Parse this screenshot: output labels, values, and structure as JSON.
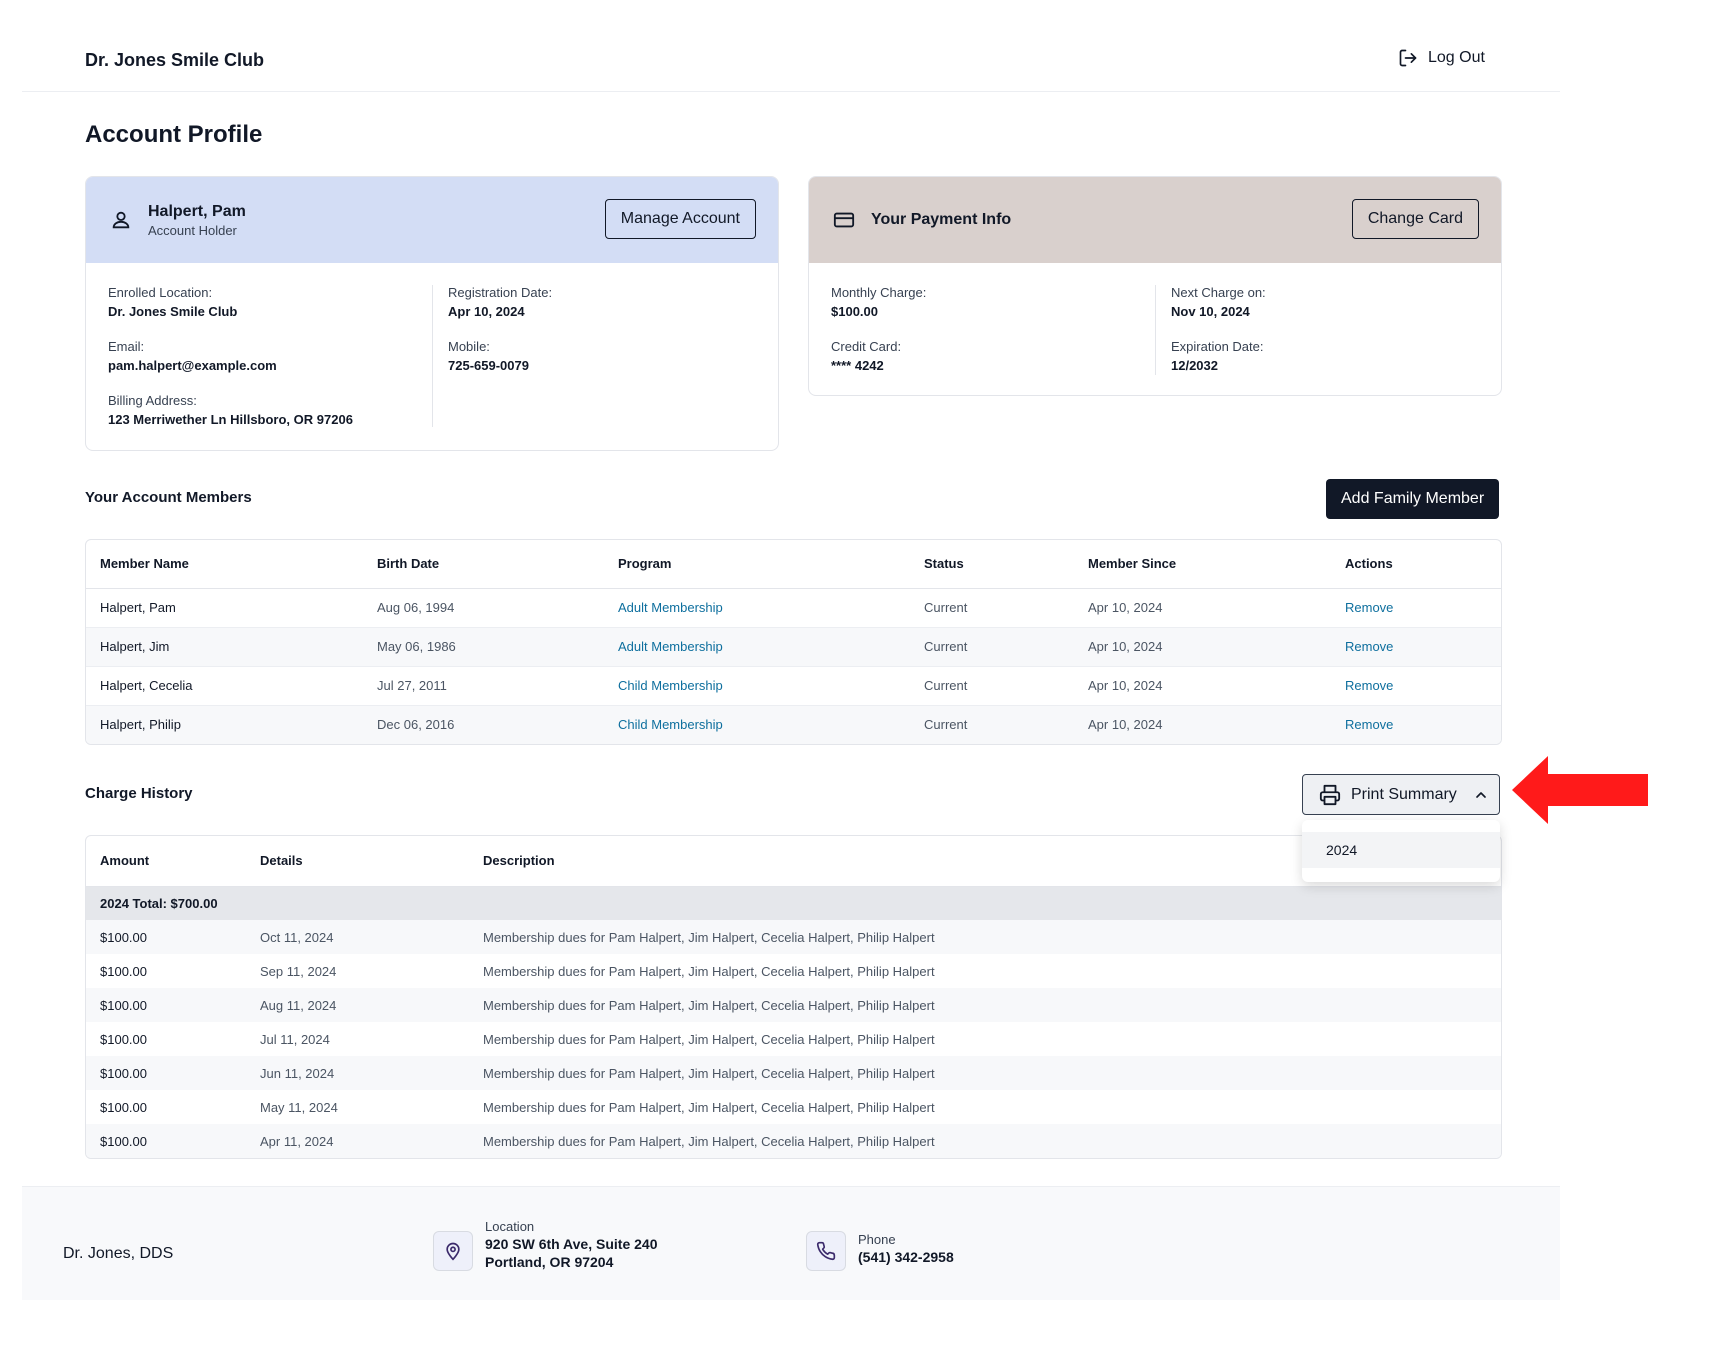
{
  "header": {
    "brand": "Dr. Jones Smile Club",
    "logout_label": "Log Out"
  },
  "page_title": "Account Profile",
  "account_card": {
    "name": "Halpert, Pam",
    "role": "Account Holder",
    "button": "Manage Account",
    "left": [
      {
        "label": "Enrolled Location:",
        "value": "Dr. Jones Smile Club"
      },
      {
        "label": "Email:",
        "value": "pam.halpert@example.com"
      },
      {
        "label": "Billing Address:",
        "value": "123 Merriwether Ln Hillsboro, OR 97206"
      }
    ],
    "right": [
      {
        "label": "Registration Date:",
        "value": "Apr 10, 2024"
      },
      {
        "label": "Mobile:",
        "value": "725-659-0079"
      }
    ]
  },
  "payment_card": {
    "title": "Your Payment Info",
    "button": "Change Card",
    "left": [
      {
        "label": "Monthly Charge:",
        "value": "$100.00"
      },
      {
        "label": "Credit Card:",
        "value": "**** 4242"
      }
    ],
    "right": [
      {
        "label": "Next Charge on:",
        "value": "Nov 10, 2024"
      },
      {
        "label": "Expiration Date:",
        "value": "12/2032"
      }
    ]
  },
  "members": {
    "title": "Your Account Members",
    "add_button": "Add Family Member",
    "columns": [
      "Member Name",
      "Birth Date",
      "Program",
      "Status",
      "Member Since",
      "Actions"
    ],
    "rows": [
      {
        "name": "Halpert, Pam",
        "birth": "Aug 06, 1994",
        "program": "Adult Membership",
        "status": "Current",
        "since": "Apr 10, 2024",
        "action": "Remove"
      },
      {
        "name": "Halpert, Jim",
        "birth": "May 06, 1986",
        "program": "Adult Membership",
        "status": "Current",
        "since": "Apr 10, 2024",
        "action": "Remove"
      },
      {
        "name": "Halpert, Cecelia",
        "birth": "Jul 27, 2011",
        "program": "Child Membership",
        "status": "Current",
        "since": "Apr 10, 2024",
        "action": "Remove"
      },
      {
        "name": "Halpert, Philip",
        "birth": "Dec 06, 2016",
        "program": "Child Membership",
        "status": "Current",
        "since": "Apr 10, 2024",
        "action": "Remove"
      }
    ]
  },
  "charges": {
    "title": "Charge History",
    "print_button": "Print Summary",
    "dropdown_options": [
      "2024"
    ],
    "columns": [
      "Amount",
      "Details",
      "Description"
    ],
    "total_label": "2024 Total: $700.00",
    "rows": [
      {
        "amount": "$100.00",
        "date": "Oct 11, 2024",
        "desc": "Membership dues for Pam Halpert, Jim Halpert, Cecelia Halpert, Philip Halpert"
      },
      {
        "amount": "$100.00",
        "date": "Sep 11, 2024",
        "desc": "Membership dues for Pam Halpert, Jim Halpert, Cecelia Halpert, Philip Halpert"
      },
      {
        "amount": "$100.00",
        "date": "Aug 11, 2024",
        "desc": "Membership dues for Pam Halpert, Jim Halpert, Cecelia Halpert, Philip Halpert"
      },
      {
        "amount": "$100.00",
        "date": "Jul 11, 2024",
        "desc": "Membership dues for Pam Halpert, Jim Halpert, Cecelia Halpert, Philip Halpert"
      },
      {
        "amount": "$100.00",
        "date": "Jun 11, 2024",
        "desc": "Membership dues for Pam Halpert, Jim Halpert, Cecelia Halpert, Philip Halpert"
      },
      {
        "amount": "$100.00",
        "date": "May 11, 2024",
        "desc": "Membership dues for Pam Halpert, Jim Halpert, Cecelia Halpert, Philip Halpert"
      },
      {
        "amount": "$100.00",
        "date": "Apr 11, 2024",
        "desc": "Membership dues for Pam Halpert, Jim Halpert, Cecelia Halpert, Philip Halpert"
      }
    ]
  },
  "footer": {
    "name": "Dr. Jones, DDS",
    "location_label": "Location",
    "location_line1": "920 SW 6th Ave, Suite 240",
    "location_line2": "Portland, OR 97204",
    "phone_label": "Phone",
    "phone": "(541) 342-2958"
  },
  "colors": {
    "account_header": "#d3ddf5",
    "payment_header": "#d9d0cd",
    "link": "#0e6f9e",
    "dark_button": "#111827",
    "annotation_arrow": "#ff1a1a"
  },
  "icons": {
    "logout": "logout-icon",
    "user": "user-icon",
    "card": "credit-card-icon",
    "printer": "printer-icon",
    "chevron": "chevron-up-icon",
    "location": "map-pin-icon",
    "phone": "phone-icon"
  }
}
